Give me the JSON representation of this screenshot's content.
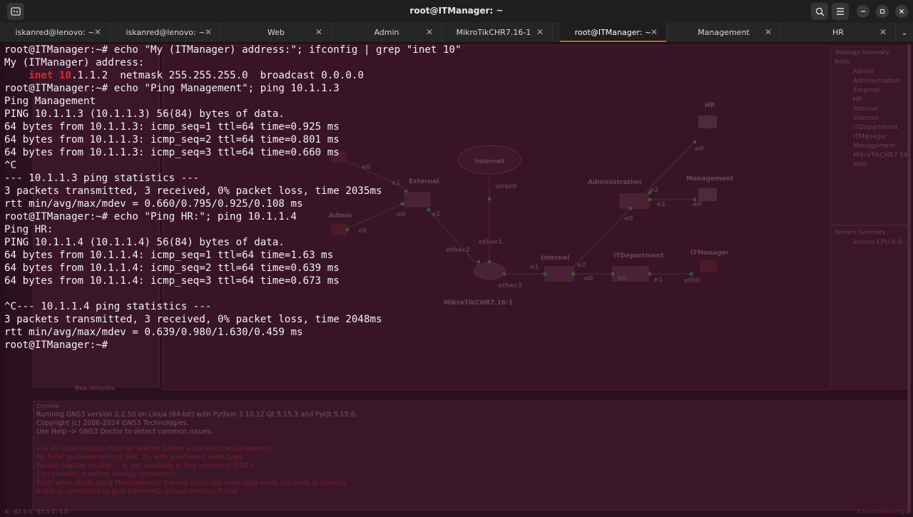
{
  "window": {
    "title": "root@ITManager: ~",
    "icons": {
      "terminal": "terminal-icon",
      "search": "search-icon",
      "menu": "hamburger-menu-icon",
      "minimize": "minimize-icon",
      "maximize": "maximize-icon",
      "close": "close-icon"
    }
  },
  "tabs": [
    {
      "label": "iskanred@lenovo: ~",
      "active": false
    },
    {
      "label": "iskanred@lenovo: ~",
      "active": false
    },
    {
      "label": "Web",
      "active": false
    },
    {
      "label": "Admin",
      "active": false
    },
    {
      "label": "MikroTikCHR7.16-1",
      "active": false
    },
    {
      "label": "root@ITManager: ~",
      "active": true
    },
    {
      "label": "Management",
      "active": false
    },
    {
      "label": "HR",
      "active": false
    }
  ],
  "terminal": {
    "lines": [
      "root@ITManager:~# echo \"My (ITManager) address:\"; ifconfig | grep \"inet 10\"",
      "My (ITManager) address:",
      "",
      "root@ITManager:~# echo \"Ping Management\"; ping 10.1.1.3",
      "Ping Management",
      "PING 10.1.1.3 (10.1.1.3) 56(84) bytes of data.",
      "64 bytes from 10.1.1.3: icmp_seq=1 ttl=64 time=0.925 ms",
      "64 bytes from 10.1.1.3: icmp_seq=2 ttl=64 time=0.801 ms",
      "64 bytes from 10.1.1.3: icmp_seq=3 ttl=64 time=0.660 ms",
      "^C",
      "--- 10.1.1.3 ping statistics ---",
      "3 packets transmitted, 3 received, 0% packet loss, time 2035ms",
      "rtt min/avg/max/mdev = 0.660/0.795/0.925/0.108 ms",
      "root@ITManager:~# echo \"Ping HR:\"; ping 10.1.1.4",
      "Ping HR:",
      "PING 10.1.1.4 (10.1.1.4) 56(84) bytes of data.",
      "64 bytes from 10.1.1.4: icmp_seq=1 ttl=64 time=1.63 ms",
      "64 bytes from 10.1.1.4: icmp_seq=2 ttl=64 time=0.639 ms",
      "64 bytes from 10.1.1.4: icmp_seq=3 ttl=64 time=0.673 ms",
      "",
      "^C--- 10.1.1.4 ping statistics ---",
      "3 packets transmitted, 3 received, 0% packet loss, time 2048ms",
      "rtt min/avg/max/mdev = 0.639/0.980/1.630/0.459 ms",
      "root@ITManager:~#"
    ],
    "inet_line": {
      "indent": "    ",
      "match1": "inet",
      "space": " ",
      "match2": "10",
      "rest": ".1.1.2  netmask 255.255.255.0  broadcast 0.0.0.0"
    },
    "highlight_color": "#e0262a"
  },
  "gns3": {
    "topology_summary_title": "Topology Summary",
    "topology_header": "Node",
    "topology_nodes": [
      "Admin",
      "Administration",
      "External",
      "HR",
      "Internal",
      "Internet",
      "ITDepartment",
      "ITManager",
      "Management",
      "MikroTikCHR7.16-1",
      "Web"
    ],
    "servers_title": "Servers Summary",
    "server": "lenovo CPU 6.9...",
    "new_template": "New template",
    "console_title": "Console",
    "console_lines": [
      {
        "text": "Running GNS3 version 2.2.50 on Linux (64-bit) with Python 3.10.12 Qt 5.15.3 and PyQt 5.15.6.",
        "type": "info"
      },
      {
        "text": "Copyright (c) 2006-2024 GNS3 Technologies.",
        "type": "info"
      },
      {
        "text": "Use Help -> GNS3 Doctor to detect common issues.",
        "type": "info"
      },
      {
        "text": "",
        "type": "info"
      },
      {
        "text": "=> All local node(s) must be started before a console can be opened",
        "type": "error"
      },
      {
        "text": "No Filter available for this link. Try with a different node type.",
        "type": "error"
      },
      {
        "text": "Packet capture on link ... is not available in this version of GNS3",
        "type": "error"
      },
      {
        "text": "Can't modify a switch already connected.",
        "type": "error"
      },
      {
        "text": "Error while duplicating Management: Cannot duplicate node data while the node is running",
        "type": "error"
      },
      {
        "text": "A link is connected to port Ethernet2, please remove it first",
        "type": "error"
      }
    ],
    "status_left": "X: -62.5 Y: -52.5 Z: 1.0",
    "status_right": "4 errors/warnings",
    "nodes": {
      "internet": "Internet",
      "external": "External",
      "admin": "Admin",
      "hr": "HR",
      "administration": "Administration",
      "management": "Management",
      "internal": "Internal",
      "itdepartment": "ITDepartment",
      "itmanager": "ITManager",
      "mikrotik": "MikroTikCHR7.16-1"
    },
    "ports": {
      "virbr0": "virbr0",
      "e0a": "e0",
      "e1a": "e1",
      "e0b": "e0",
      "e2a": "e2",
      "e0c": "e0",
      "ether2": "ether2",
      "ether1": "ether1",
      "ether3": "ether3",
      "e1b": "e1",
      "e2b": "e2",
      "e0d": "e0",
      "e0e": "e0",
      "e1c": "e1",
      "eth0": "eth0",
      "e0f": "e0",
      "e2c": "e2",
      "e1d": "e1",
      "e0g": "e0",
      "e0h": "e0",
      "e0i": "e0"
    }
  }
}
